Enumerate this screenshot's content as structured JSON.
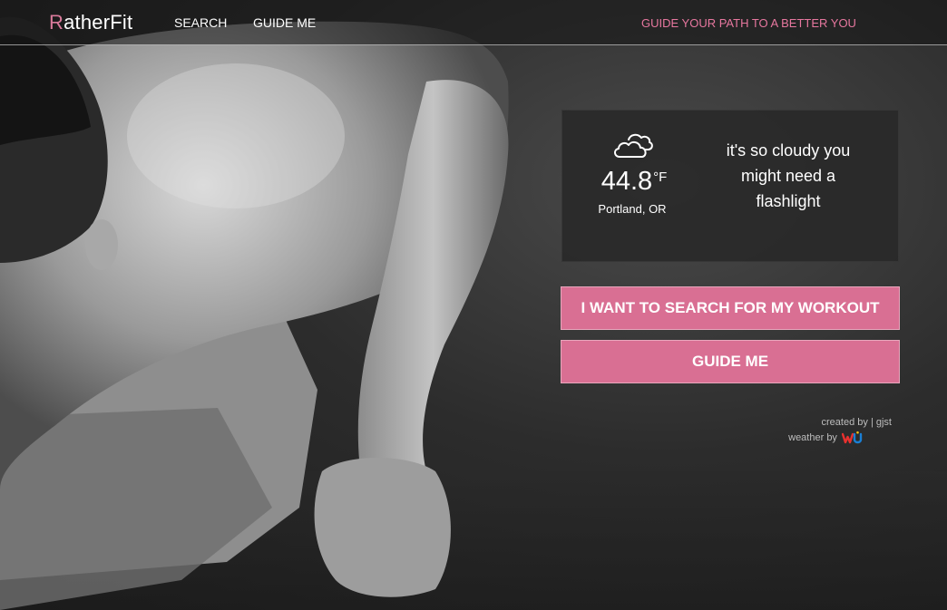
{
  "nav": {
    "brand_initial": "R",
    "brand_rest": "atherFit",
    "links": [
      "SEARCH",
      "GUIDE ME"
    ],
    "tagline": "GUIDE YOUR PATH TO A BETTER YOU"
  },
  "weather": {
    "icon": "cloud-icon",
    "temperature": "44.8",
    "unit": "°F",
    "location": "Portland, OR",
    "message": "it's so cloudy you might need a flashlight"
  },
  "actions": {
    "search_label": "I WANT TO SEARCH FOR MY WORKOUT",
    "guide_label": "GUIDE ME"
  },
  "credits": {
    "created_by_label": "created by",
    "separator": "|",
    "author": "gjst",
    "weather_by_label": "weather by",
    "weather_provider_logo": "wu-logo"
  },
  "colors": {
    "accent": "#d96f93",
    "tagline": "#e7779f",
    "card_bg": "#282828"
  }
}
